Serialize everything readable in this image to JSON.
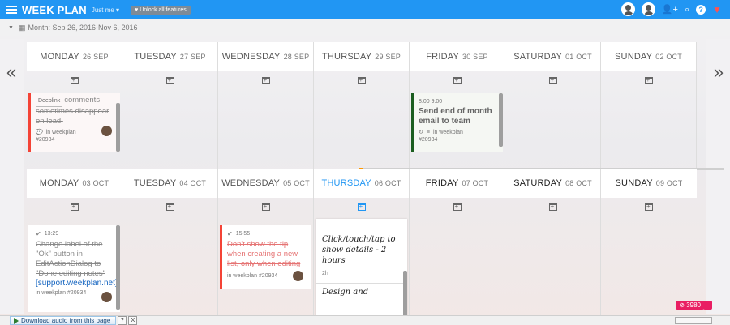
{
  "header": {
    "title": "WEEK PLAN",
    "scope": "Just me",
    "unlock_label": "Unlock all features"
  },
  "month_label": "Month: Sep 26, 2016-Nov 6, 2016",
  "week1": [
    {
      "name": "MONDAY",
      "date": "26 SEP"
    },
    {
      "name": "TUESDAY",
      "date": "27 SEP"
    },
    {
      "name": "WEDNESDAY",
      "date": "28 SEP"
    },
    {
      "name": "THURSDAY",
      "date": "29 SEP"
    },
    {
      "name": "FRIDAY",
      "date": "30 SEP"
    },
    {
      "name": "SATURDAY",
      "date": "01 OCT"
    },
    {
      "name": "SUNDAY",
      "date": "02 OCT"
    }
  ],
  "week2": [
    {
      "name": "MONDAY",
      "date": "03 OCT"
    },
    {
      "name": "TUESDAY",
      "date": "04 OCT"
    },
    {
      "name": "WEDNESDAY",
      "date": "05 OCT"
    },
    {
      "name": "THURSDAY",
      "date": "06 OCT"
    },
    {
      "name": "FRIDAY",
      "date": "07 OCT"
    },
    {
      "name": "SATURDAY",
      "date": "08 OCT"
    },
    {
      "name": "SUNDAY",
      "date": "09 OCT"
    }
  ],
  "tasks": {
    "t1": {
      "tag": "Deeplink",
      "text": "comments sometimes disappear on load.",
      "list": "in weekplan",
      "id": "#20934"
    },
    "t2": {
      "time": "8:00 9:00",
      "title": "Send end of month email to team",
      "list": "in weekplan",
      "id": "#20934"
    },
    "t3": {
      "time": "13:29",
      "text": "Change label of the \"Ok\" button in EditActionDialog to \"Done editing notes\"",
      "link": "[support.weekplan.net]",
      "list": "in weekplan #20934"
    },
    "t4": {
      "time": "15:55",
      "text": "Don't show the tip when creating a new list, only when editing",
      "list": "in weekplan #20934"
    },
    "t5": {
      "text": "Click/touch/tap to show details - 2 hours",
      "dur": "2h",
      "text2": "Design and"
    }
  },
  "badge_count": "3980",
  "bottom": {
    "download_label": "Download audio from this page",
    "q": "?",
    "x": "X"
  }
}
